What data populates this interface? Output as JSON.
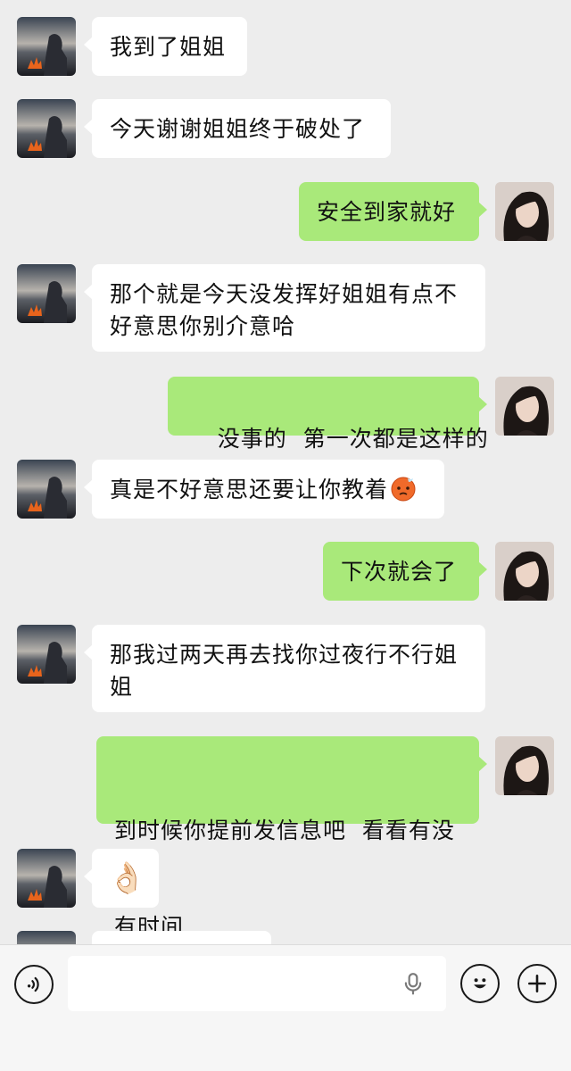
{
  "conversation": {
    "messages": [
      {
        "side": "in",
        "text": "我到了姐姐"
      },
      {
        "side": "in",
        "text": "今天谢谢姐姐终于破处了"
      },
      {
        "side": "out",
        "text": "安全到家就好"
      },
      {
        "side": "in",
        "lines": [
          "那个就是今天没发挥好姐姐有点不",
          "好意思你别介意哈"
        ]
      },
      {
        "side": "out",
        "text": "没事的  第一次都是这样的"
      },
      {
        "side": "in",
        "text": "真是不好意思还要让你教着",
        "emoji": "blushing-face-emoji"
      },
      {
        "side": "out",
        "text": "下次就会了"
      },
      {
        "side": "in",
        "lines": [
          "那我过两天再去找你过夜行不行姐",
          "姐"
        ]
      },
      {
        "side": "out",
        "lines": [
          "到时候你提前发信息吧  看看有没",
          "有时间"
        ]
      },
      {
        "side": "in",
        "text": "👌🏻"
      },
      {
        "side": "in",
        "text": ""
      }
    ]
  },
  "composer": {
    "input_value": "",
    "icons": [
      "voice-icon",
      "microphone-icon",
      "emoji-icon",
      "plus-icon"
    ]
  },
  "colors": {
    "background": "#ededed",
    "incoming_bubble": "#ffffff",
    "outgoing_bubble": "#a9e97a",
    "composer_bar": "#f6f6f6"
  }
}
